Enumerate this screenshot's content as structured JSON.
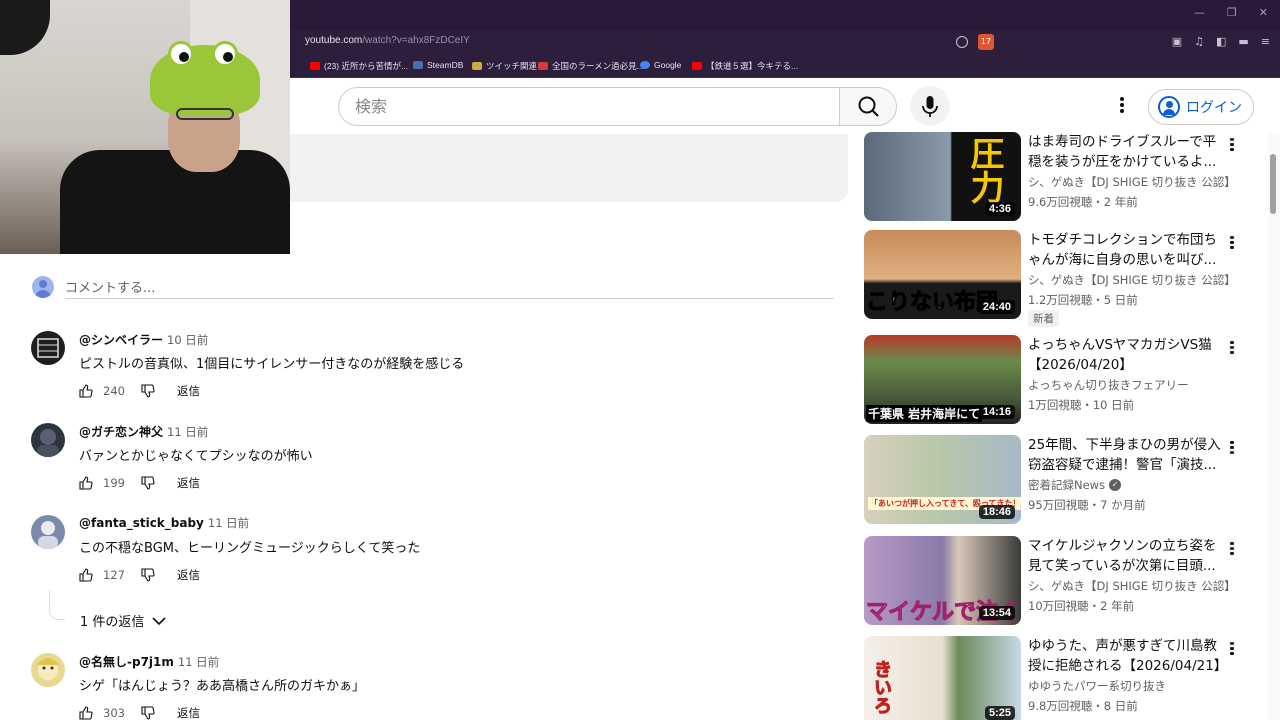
{
  "browser": {
    "url_host": "youtube.com",
    "url_path": "/watch?v=ahx8FzDCeIY",
    "extension_count": "17",
    "bookmarks": [
      {
        "label": "(23) 近所から苦情が...",
        "color": "#ff0000"
      },
      {
        "label": "SteamDB",
        "color": "#4a6ea9"
      },
      {
        "label": "ツイッチ関連",
        "color": "#c9a94a"
      },
      {
        "label": "全国のラーメン過必見...",
        "color": "#d33c3c"
      },
      {
        "label": "Google",
        "color": "#4285f4"
      },
      {
        "label": "【鉄道５選】今キテる...",
        "color": "#ff0000"
      }
    ]
  },
  "header": {
    "search_placeholder": "検索",
    "login_label": "ログイン"
  },
  "comments": {
    "input_placeholder": "コメントする...",
    "items": [
      {
        "author": "@シンベイラー",
        "time": "10 日前",
        "text": "ピストルの音真似、1個目にサイレンサー付きなのが経験を感じる",
        "likes": "240",
        "reply": "返信",
        "avatar_color": "#1e1e1e"
      },
      {
        "author": "@ガチ恋ン神父",
        "time": "11 日前",
        "text": "バァンとかじゃなくてプシッなのが怖い",
        "likes": "199",
        "reply": "返信",
        "avatar_color": "#2e3440"
      },
      {
        "author": "@fanta_stick_baby",
        "time": "11 日前",
        "text": "この不穏なBGM、ヒーリングミュージックらしくて笑った",
        "likes": "127",
        "reply": "返信",
        "avatar_color": "#7a8aa8"
      },
      {
        "author": "@名無し-p7j1m",
        "time": "11 日前",
        "text": "シゲ「はんじょう？ああ高橋さん所のガキかぁ」",
        "likes": "303",
        "reply": "返信",
        "avatar_color": "#e8d890"
      }
    ],
    "replies_toggle": "1 件の返信"
  },
  "recommendations": [
    {
      "title": "はま寿司のドライブスルーで平穏を装うが圧をかけているよ...",
      "channel": "シ、ゲぬき【DJ SHIGE 切り抜き 公認】",
      "meta": "9.6万回視聴・2 年前",
      "duration": "4:36",
      "caption": "圧力",
      "verified": false,
      "badge": ""
    },
    {
      "title": "トモダチコレクションで布団ちゃんが海に自身の思いを叫び...",
      "channel": "シ、ゲぬき【DJ SHIGE 切り抜き 公認】",
      "meta": "1.2万回視聴・5 日前",
      "duration": "24:40",
      "caption": "こりない布団",
      "verified": false,
      "badge": "新着"
    },
    {
      "title": "よっちゃんVSヤマカガシVS猫【2026/04/20】",
      "channel": "よっちゃん切り抜きフェアリー",
      "meta": "1万回視聴・10 日前",
      "duration": "14:16",
      "caption": "千葉県 岩井海岸にて",
      "verified": false,
      "badge": ""
    },
    {
      "title": "25年間、下半身まひの男が侵入窃盗容疑で逮捕！警官「演技...",
      "channel": "密着記録News",
      "meta": "95万回視聴・7 か月前",
      "duration": "18:46",
      "caption": "「あいつが押し入ってきて、殴ってきた！」",
      "verified": true,
      "badge": ""
    },
    {
      "title": "マイケルジャクソンの立ち姿を見て笑っているが次第に目頭...",
      "channel": "シ、ゲぬき【DJ SHIGE 切り抜き 公認】",
      "meta": "10万回視聴・2 年前",
      "duration": "13:54",
      "caption": "マイケルで泣く",
      "verified": false,
      "badge": ""
    },
    {
      "title": "ゆゆうた、声が悪すぎて川島教授に拒絶される【2026/04/21】",
      "channel": "ゆゆうたパワー系切り抜き",
      "meta": "9.8万回視聴・8 日前",
      "duration": "5:25",
      "caption": "きいろ",
      "verified": false,
      "badge": ""
    }
  ]
}
